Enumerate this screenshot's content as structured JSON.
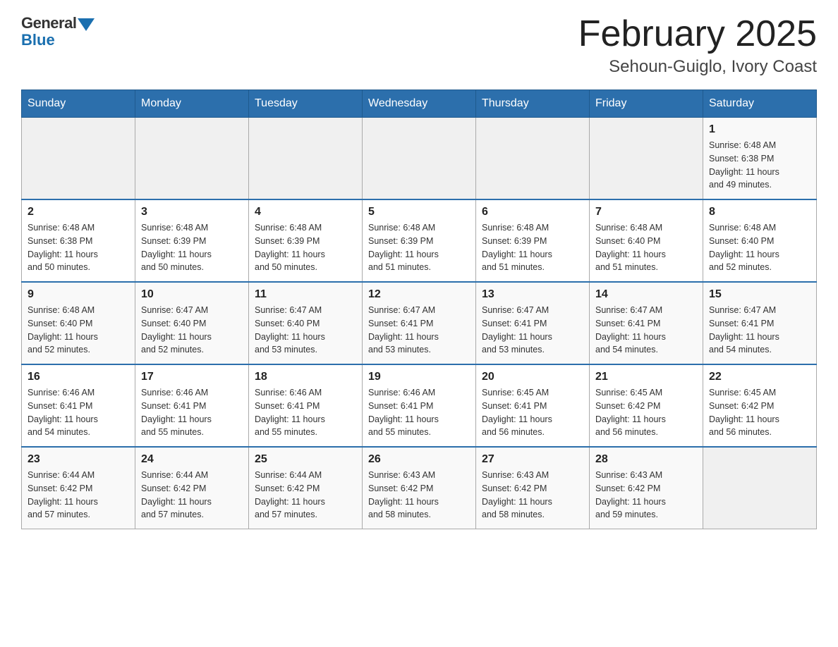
{
  "header": {
    "logo_general": "General",
    "logo_blue": "Blue",
    "title": "February 2025",
    "subtitle": "Sehoun-Guiglo, Ivory Coast"
  },
  "days_of_week": [
    "Sunday",
    "Monday",
    "Tuesday",
    "Wednesday",
    "Thursday",
    "Friday",
    "Saturday"
  ],
  "weeks": [
    [
      {
        "day": "",
        "info": ""
      },
      {
        "day": "",
        "info": ""
      },
      {
        "day": "",
        "info": ""
      },
      {
        "day": "",
        "info": ""
      },
      {
        "day": "",
        "info": ""
      },
      {
        "day": "",
        "info": ""
      },
      {
        "day": "1",
        "info": "Sunrise: 6:48 AM\nSunset: 6:38 PM\nDaylight: 11 hours\nand 49 minutes."
      }
    ],
    [
      {
        "day": "2",
        "info": "Sunrise: 6:48 AM\nSunset: 6:38 PM\nDaylight: 11 hours\nand 50 minutes."
      },
      {
        "day": "3",
        "info": "Sunrise: 6:48 AM\nSunset: 6:39 PM\nDaylight: 11 hours\nand 50 minutes."
      },
      {
        "day": "4",
        "info": "Sunrise: 6:48 AM\nSunset: 6:39 PM\nDaylight: 11 hours\nand 50 minutes."
      },
      {
        "day": "5",
        "info": "Sunrise: 6:48 AM\nSunset: 6:39 PM\nDaylight: 11 hours\nand 51 minutes."
      },
      {
        "day": "6",
        "info": "Sunrise: 6:48 AM\nSunset: 6:39 PM\nDaylight: 11 hours\nand 51 minutes."
      },
      {
        "day": "7",
        "info": "Sunrise: 6:48 AM\nSunset: 6:40 PM\nDaylight: 11 hours\nand 51 minutes."
      },
      {
        "day": "8",
        "info": "Sunrise: 6:48 AM\nSunset: 6:40 PM\nDaylight: 11 hours\nand 52 minutes."
      }
    ],
    [
      {
        "day": "9",
        "info": "Sunrise: 6:48 AM\nSunset: 6:40 PM\nDaylight: 11 hours\nand 52 minutes."
      },
      {
        "day": "10",
        "info": "Sunrise: 6:47 AM\nSunset: 6:40 PM\nDaylight: 11 hours\nand 52 minutes."
      },
      {
        "day": "11",
        "info": "Sunrise: 6:47 AM\nSunset: 6:40 PM\nDaylight: 11 hours\nand 53 minutes."
      },
      {
        "day": "12",
        "info": "Sunrise: 6:47 AM\nSunset: 6:41 PM\nDaylight: 11 hours\nand 53 minutes."
      },
      {
        "day": "13",
        "info": "Sunrise: 6:47 AM\nSunset: 6:41 PM\nDaylight: 11 hours\nand 53 minutes."
      },
      {
        "day": "14",
        "info": "Sunrise: 6:47 AM\nSunset: 6:41 PM\nDaylight: 11 hours\nand 54 minutes."
      },
      {
        "day": "15",
        "info": "Sunrise: 6:47 AM\nSunset: 6:41 PM\nDaylight: 11 hours\nand 54 minutes."
      }
    ],
    [
      {
        "day": "16",
        "info": "Sunrise: 6:46 AM\nSunset: 6:41 PM\nDaylight: 11 hours\nand 54 minutes."
      },
      {
        "day": "17",
        "info": "Sunrise: 6:46 AM\nSunset: 6:41 PM\nDaylight: 11 hours\nand 55 minutes."
      },
      {
        "day": "18",
        "info": "Sunrise: 6:46 AM\nSunset: 6:41 PM\nDaylight: 11 hours\nand 55 minutes."
      },
      {
        "day": "19",
        "info": "Sunrise: 6:46 AM\nSunset: 6:41 PM\nDaylight: 11 hours\nand 55 minutes."
      },
      {
        "day": "20",
        "info": "Sunrise: 6:45 AM\nSunset: 6:41 PM\nDaylight: 11 hours\nand 56 minutes."
      },
      {
        "day": "21",
        "info": "Sunrise: 6:45 AM\nSunset: 6:42 PM\nDaylight: 11 hours\nand 56 minutes."
      },
      {
        "day": "22",
        "info": "Sunrise: 6:45 AM\nSunset: 6:42 PM\nDaylight: 11 hours\nand 56 minutes."
      }
    ],
    [
      {
        "day": "23",
        "info": "Sunrise: 6:44 AM\nSunset: 6:42 PM\nDaylight: 11 hours\nand 57 minutes."
      },
      {
        "day": "24",
        "info": "Sunrise: 6:44 AM\nSunset: 6:42 PM\nDaylight: 11 hours\nand 57 minutes."
      },
      {
        "day": "25",
        "info": "Sunrise: 6:44 AM\nSunset: 6:42 PM\nDaylight: 11 hours\nand 57 minutes."
      },
      {
        "day": "26",
        "info": "Sunrise: 6:43 AM\nSunset: 6:42 PM\nDaylight: 11 hours\nand 58 minutes."
      },
      {
        "day": "27",
        "info": "Sunrise: 6:43 AM\nSunset: 6:42 PM\nDaylight: 11 hours\nand 58 minutes."
      },
      {
        "day": "28",
        "info": "Sunrise: 6:43 AM\nSunset: 6:42 PM\nDaylight: 11 hours\nand 59 minutes."
      },
      {
        "day": "",
        "info": ""
      }
    ]
  ]
}
